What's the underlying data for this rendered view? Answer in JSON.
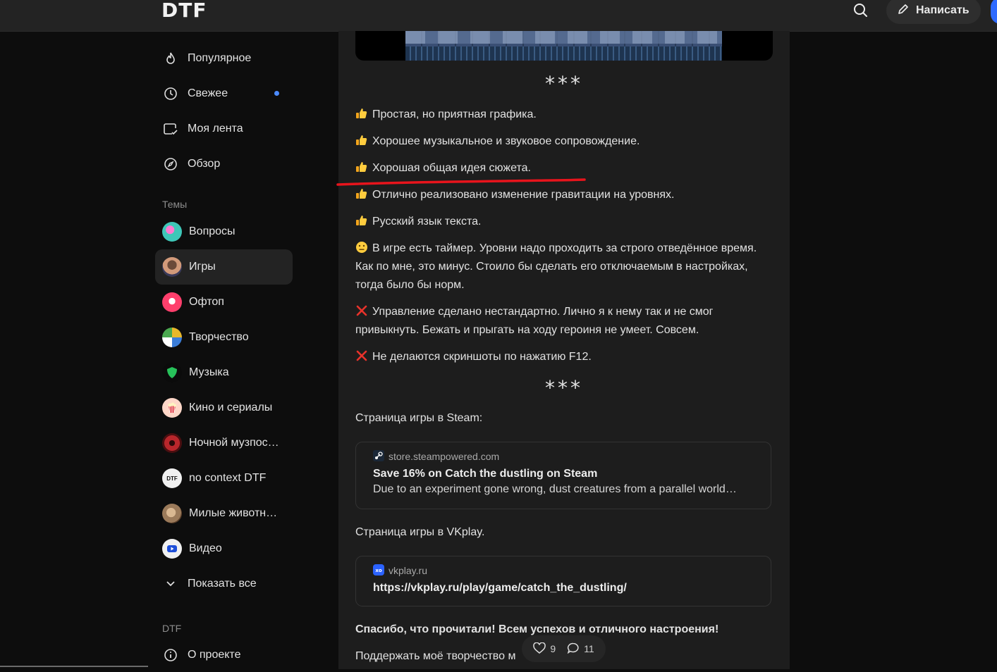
{
  "header": {
    "logo": "DTF",
    "write_label": "Написать"
  },
  "sidebar": {
    "nav": [
      {
        "label": "Популярное",
        "icon": "flame-icon"
      },
      {
        "label": "Свежее",
        "icon": "clock-icon",
        "has_new": true
      },
      {
        "label": "Моя лента",
        "icon": "feed-icon"
      },
      {
        "label": "Обзор",
        "icon": "compass-icon"
      }
    ],
    "topics_label": "Темы",
    "topics": [
      {
        "label": "Вопросы",
        "color": "#3ec7b8"
      },
      {
        "label": "Игры",
        "color": "#d29a7a",
        "active": true
      },
      {
        "label": "Офтоп",
        "color": "#ff3f6c"
      },
      {
        "label": "Творчество",
        "color": "#e9b82a"
      },
      {
        "label": "Музыка",
        "color": "#0b0b0b"
      },
      {
        "label": "Кино и сериалы",
        "color": "#ffd7c8"
      },
      {
        "label": "Ночной музпос…",
        "color": "#b8262b"
      },
      {
        "label": "no context DTF",
        "color": "#f0f0f0"
      },
      {
        "label": "Милые животн…",
        "color": "#9b7a5a"
      },
      {
        "label": "Видео",
        "color": "#f0f0f0"
      }
    ],
    "show_all": "Показать все",
    "dtf_label": "DTF",
    "about": "О проекте"
  },
  "article": {
    "separator": "***",
    "bullets": [
      {
        "icon": "thumbs-up-icon",
        "text": "Простая, но приятная графика."
      },
      {
        "icon": "thumbs-up-icon",
        "text": "Хорошее музыкальное и звуковое сопровождение."
      },
      {
        "icon": "thumbs-up-icon",
        "text": "Хорошая общая идея сюжета."
      },
      {
        "icon": "thumbs-up-icon",
        "text": "Отлично реализовано изменение гравитации на уровнях."
      },
      {
        "icon": "thumbs-up-icon",
        "text": "Русский язык текста."
      },
      {
        "icon": "neutral-face-icon",
        "text": "В игре есть таймер. Уровни надо проходить за строго отведённое время. Как по мне, это минус. Стоило бы сделать его отключаемым в настройках, тогда было бы норм."
      },
      {
        "icon": "cross-mark-icon",
        "text": "Управление сделано нестандартно. Лично я к нему так и не смог привыкнуть. Бежать и прыгать на ходу героиня не умеет. Совсем."
      },
      {
        "icon": "cross-mark-icon",
        "text": "Не делаются скриншоты по нажатию F12."
      }
    ],
    "steam_intro": "Страница игры в Steam:",
    "steam_card": {
      "domain": "store.steampowered.com",
      "title": "Save 16% on Catch the dustling on Steam",
      "desc": "Due to an experiment gone wrong, dust creatures from a parallel world…"
    },
    "vk_intro": "Страница игры в VKplay.",
    "vk_card": {
      "domain": "vkplay.ru",
      "title": "https://vkplay.ru/play/game/catch_the_dustling/"
    },
    "thanks": "Спасибо, что прочитали! Всем успехов и отличного настроения!",
    "support": "Поддержать моё творчество м"
  },
  "reactions": {
    "likes": "9",
    "comments": "11"
  },
  "colors": {
    "accent": "#4b8bff",
    "annotation": "#e8141c"
  }
}
